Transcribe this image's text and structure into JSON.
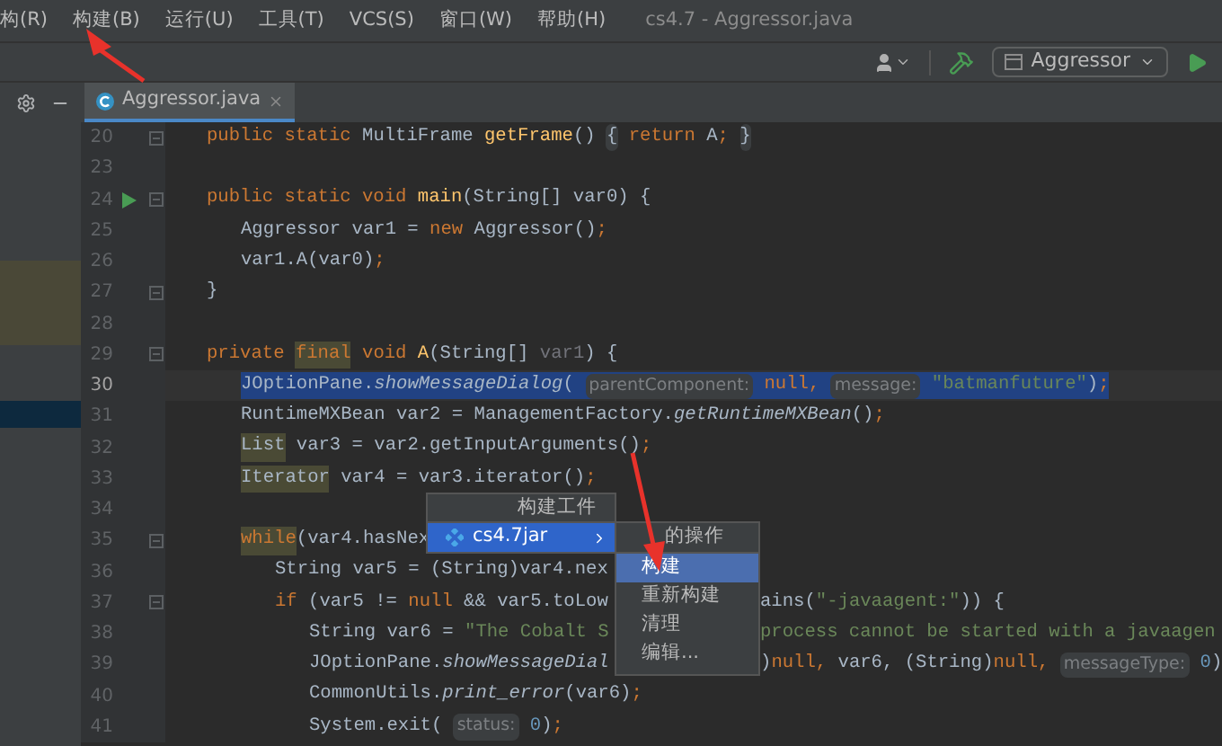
{
  "menu_bar": {
    "items": [
      {
        "label": "构(R)"
      },
      {
        "label": "构建(B)"
      },
      {
        "label": "运行(U)"
      },
      {
        "label": "工具(T)"
      },
      {
        "label": "VCS(S)"
      },
      {
        "label": "窗口(W)"
      },
      {
        "label": "帮助(H)"
      }
    ],
    "window_title": "cs4.7 - Aggressor.java"
  },
  "toolbar": {
    "run_config": "Aggressor"
  },
  "tabs": [
    {
      "label": "Aggressor.java",
      "selected": true
    }
  ],
  "code_lines": [
    {
      "num": "20",
      "selected": false,
      "fold": true,
      "kind": "member",
      "segs": [
        {
          "kind": "kw",
          "t": "public static "
        },
        {
          "kind": "id",
          "t": "MultiFrame "
        },
        {
          "kind": "mdecl",
          "t": "getFrame"
        },
        {
          "kind": "id",
          "t": "() "
        },
        {
          "kind": "fold",
          "t": "{"
        },
        {
          "kind": "kw",
          "t": " return"
        },
        {
          "kind": "id",
          "t": " A"
        },
        {
          "kind": "kw",
          "t": "; "
        },
        {
          "kind": "fold",
          "t": "}"
        }
      ]
    },
    {
      "num": "23",
      "selected": false,
      "kind": "member"
    },
    {
      "num": "24",
      "selected": false,
      "fold": true,
      "run": true,
      "kind": "member",
      "segs": [
        {
          "kind": "kw",
          "t": "public static void "
        },
        {
          "kind": "mdecl",
          "t": "main"
        },
        {
          "kind": "id",
          "t": "(String[] var0) {"
        }
      ]
    },
    {
      "num": "25",
      "selected": false,
      "kind": "body",
      "segs": [
        {
          "kind": "id",
          "t": "Aggressor var1 = "
        },
        {
          "kind": "kw",
          "t": "new"
        },
        {
          "kind": "id",
          "t": " Aggressor()"
        },
        {
          "kind": "kw",
          "t": ";"
        }
      ]
    },
    {
      "num": "26",
      "selected": false,
      "kind": "body",
      "segs": [
        {
          "kind": "id",
          "t": "var1.A(var0)"
        },
        {
          "kind": "kw",
          "t": ";"
        }
      ]
    },
    {
      "num": "27",
      "selected": false,
      "fold": true,
      "kind": "member",
      "segs": [
        {
          "kind": "id",
          "t": "}"
        }
      ]
    },
    {
      "num": "28",
      "selected": false,
      "kind": "member"
    },
    {
      "num": "29",
      "selected": false,
      "fold": true,
      "kind": "member",
      "segs": [
        {
          "kind": "kw",
          "t": "private "
        },
        {
          "kind": "hlkw",
          "t": "final"
        },
        {
          "kind": "kw",
          "t": " void "
        },
        {
          "kind": "mdecl",
          "t": "A"
        },
        {
          "kind": "id",
          "t": "(String[] "
        },
        {
          "kind": "unused",
          "t": "var1"
        },
        {
          "kind": "id",
          "t": ") {"
        }
      ]
    },
    {
      "num": "30",
      "selected": true,
      "kind": "body",
      "segs": [
        {
          "kind": "id",
          "t": "JOptionPane."
        },
        {
          "kind": "static",
          "t": "showMessageDialog"
        },
        {
          "kind": "id",
          "t": "( "
        },
        {
          "kind": "hint",
          "t": "parentComponent:"
        },
        {
          "kind": "kw",
          "t": " null, "
        },
        {
          "kind": "hint",
          "t": "message:"
        },
        {
          "kind": "str",
          "t": " \"batmanfuture\""
        },
        {
          "kind": "id",
          "t": ")"
        },
        {
          "kind": "kw",
          "t": ";"
        }
      ]
    },
    {
      "num": "31",
      "selected": false,
      "kind": "body",
      "segs": [
        {
          "kind": "id",
          "t": "RuntimeMXBean var2 = ManagementFactory."
        },
        {
          "kind": "static",
          "t": "getRuntimeMXBean"
        },
        {
          "kind": "id",
          "t": "()"
        },
        {
          "kind": "kw",
          "t": ";"
        }
      ]
    },
    {
      "num": "32",
      "selected": false,
      "kind": "body",
      "segs": [
        {
          "kind": "hlid",
          "t": "List"
        },
        {
          "kind": "id",
          "t": " var3 = var2.getInputArguments()"
        },
        {
          "kind": "kw",
          "t": ";"
        }
      ]
    },
    {
      "num": "33",
      "selected": false,
      "kind": "body",
      "segs": [
        {
          "kind": "hlid",
          "t": "Iterator"
        },
        {
          "kind": "id",
          "t": " var4 = var3.iterator()"
        },
        {
          "kind": "kw",
          "t": ";"
        }
      ]
    },
    {
      "num": "34",
      "selected": false,
      "kind": "body"
    },
    {
      "num": "35",
      "selected": false,
      "fold": true,
      "kind": "body",
      "segs": [
        {
          "kind": "hlkw",
          "t": "while"
        },
        {
          "kind": "id",
          "t": "(var4.hasNex"
        }
      ]
    },
    {
      "num": "36",
      "selected": false,
      "kind": "loop",
      "segs": [
        {
          "kind": "id",
          "t": "String var5 = (String)var4.nex"
        }
      ]
    },
    {
      "num": "37",
      "selected": false,
      "fold": true,
      "kind": "loop",
      "segs": [
        {
          "kind": "kw",
          "t": "if"
        },
        {
          "kind": "id",
          "t": " (var5 != "
        },
        {
          "kind": "kw",
          "t": "null"
        },
        {
          "kind": "id",
          "t": " && var5.toLow"
        }
      ],
      "tail": [
        {
          "kind": "id",
          "t": "ains("
        },
        {
          "kind": "str",
          "t": "\"-javaagent:\""
        },
        {
          "kind": "id",
          "t": ")) {"
        }
      ]
    },
    {
      "num": "38",
      "selected": false,
      "kind": "branch",
      "segs": [
        {
          "kind": "id",
          "t": "String var6 = "
        },
        {
          "kind": "str",
          "t": "\"The Cobalt S"
        }
      ],
      "tail": [
        {
          "kind": "str",
          "t": "process cannot be started with a javaagen"
        }
      ]
    },
    {
      "num": "39",
      "selected": false,
      "kind": "branch",
      "segs": [
        {
          "kind": "id",
          "t": "JOptionPane."
        },
        {
          "kind": "static",
          "t": "showMessageDial"
        }
      ],
      "tail": [
        {
          "kind": "id",
          "t": ")"
        },
        {
          "kind": "kw",
          "t": "null, "
        },
        {
          "kind": "id",
          "t": "var6, (String)"
        },
        {
          "kind": "kw",
          "t": "null, "
        },
        {
          "kind": "hint",
          "t": "messageType:"
        },
        {
          "kind": "num",
          "t": " 0"
        },
        {
          "kind": "id",
          "t": ")"
        }
      ]
    },
    {
      "num": "40",
      "selected": false,
      "kind": "branch",
      "segs": [
        {
          "kind": "id",
          "t": "CommonUtils."
        },
        {
          "kind": "static",
          "t": "print_error"
        },
        {
          "kind": "id",
          "t": "(var6)"
        },
        {
          "kind": "kw",
          "t": ";"
        }
      ]
    },
    {
      "num": "41",
      "selected": false,
      "kind": "branch",
      "segs": [
        {
          "kind": "id",
          "t": "System.exit( "
        },
        {
          "kind": "hint",
          "t": "status:"
        },
        {
          "kind": "num",
          "t": " 0"
        },
        {
          "kind": "id",
          "t": ")"
        },
        {
          "kind": "kw",
          "t": ";"
        }
      ]
    }
  ],
  "popup": {
    "title": "构建工件",
    "items": [
      {
        "label": "cs4.7jar",
        "selected": true
      }
    ]
  },
  "submenu": {
    "title": "的操作",
    "items": [
      {
        "label": "构建",
        "selected": true
      },
      {
        "label": "重新构建",
        "selected": false
      },
      {
        "label": "清理",
        "selected": false
      },
      {
        "label": "编辑...",
        "selected": false
      }
    ]
  }
}
